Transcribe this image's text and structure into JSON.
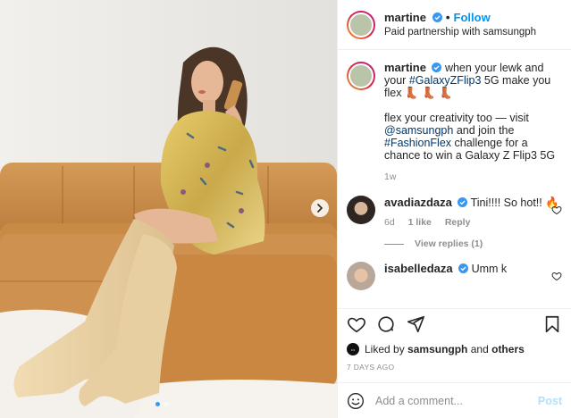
{
  "header": {
    "username": "martine",
    "follow_label": "Follow",
    "subtitle": "Paid partnership with samsungph"
  },
  "caption": {
    "username": "martine",
    "text_1": "when your lewk and your",
    "hashtag_1": "#GalaxyZFlip3",
    "text_2": "5G make you flex 👢 👢",
    "text_3": "👢",
    "text_4": "flex your creativity too — visit",
    "mention": "@samsungph",
    "text_5": "and join the",
    "hashtag_2": "#FashionFlex",
    "text_6": "challenge for a chance to win a Galaxy Z Flip3 5G",
    "age": "1w"
  },
  "comments": [
    {
      "username": "avadiazdaza",
      "text": "Tini!!!! So hot!! 🔥",
      "age": "6d",
      "likes": "1 like",
      "reply_label": "Reply",
      "view_replies": "View replies (1)"
    },
    {
      "username": "isabelledaza",
      "text": "Umm k"
    }
  ],
  "likes": {
    "prefix": "Liked by",
    "user": "samsungph",
    "connector": "and",
    "others": "others"
  },
  "timestamp": "7 DAYS AGO",
  "add_comment": {
    "placeholder": "Add a comment...",
    "post_label": "Post"
  },
  "colors": {
    "link_blue": "#0095f6",
    "verified_blue": "#3897f0",
    "hashtag": "#00376b",
    "muted": "#8e8e8e"
  },
  "carousel": {
    "current": 1,
    "total": 2
  }
}
